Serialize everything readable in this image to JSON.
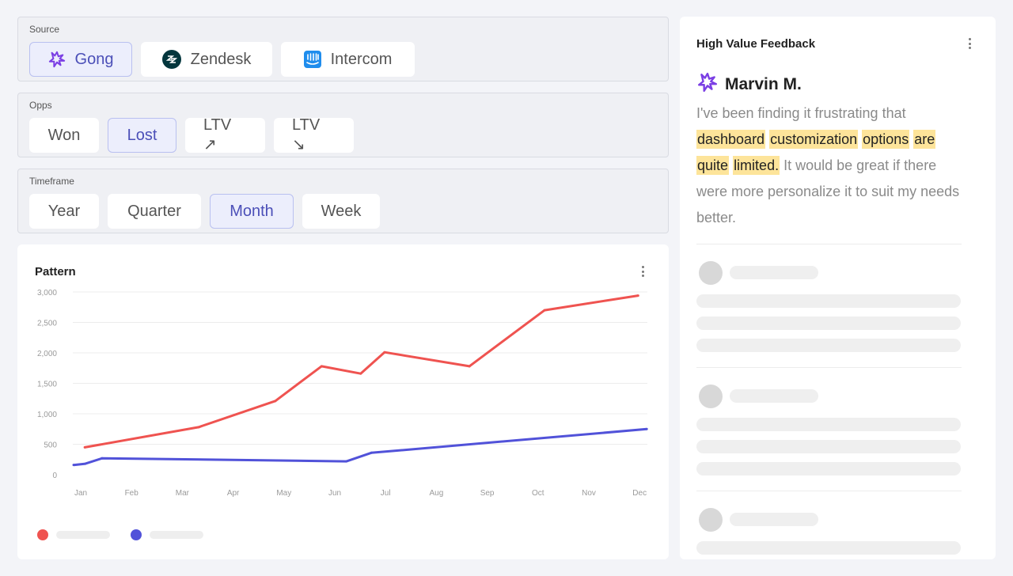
{
  "filters": {
    "source": {
      "label": "Source",
      "options": [
        {
          "label": "Gong",
          "icon": "gong-icon",
          "active": true
        },
        {
          "label": "Zendesk",
          "icon": "zendesk-icon",
          "active": false
        },
        {
          "label": "Intercom",
          "icon": "intercom-icon",
          "active": false
        }
      ]
    },
    "opps": {
      "label": "Opps",
      "options": [
        {
          "label": "Won",
          "active": false
        },
        {
          "label": "Lost",
          "active": true
        },
        {
          "label": "LTV ↗",
          "active": false
        },
        {
          "label": "LTV ↘",
          "active": false
        }
      ]
    },
    "timeframe": {
      "label": "Timeframe",
      "options": [
        {
          "label": "Year",
          "active": false
        },
        {
          "label": "Quarter",
          "active": false
        },
        {
          "label": "Month",
          "active": true
        },
        {
          "label": "Week",
          "active": false
        }
      ]
    }
  },
  "pattern_card": {
    "title": "Pattern",
    "menu_icon": "kebab-menu-icon"
  },
  "chart_data": {
    "type": "line",
    "title": "Pattern",
    "xlabel": "",
    "ylabel": "",
    "categories": [
      "Jan",
      "Feb",
      "Mar",
      "Apr",
      "May",
      "Jun",
      "Jul",
      "Aug",
      "Sep",
      "Oct",
      "Nov",
      "Dec"
    ],
    "yticks": [
      0,
      500,
      1000,
      1500,
      2000,
      2500,
      3000
    ],
    "ytick_labels": [
      "0",
      "500",
      "1,000",
      "1,500",
      "2,000",
      "2,500",
      "3,000"
    ],
    "ylim": [
      0,
      3000
    ],
    "grid": true,
    "legend": "bottom-left",
    "series": [
      {
        "name": "",
        "color": "#ef5350",
        "points": [
          {
            "x": 0.08,
            "y": 450
          },
          {
            "x": 2.32,
            "y": 780
          },
          {
            "x": 3.83,
            "y": 1210
          },
          {
            "x": 4.74,
            "y": 1780
          },
          {
            "x": 5.51,
            "y": 1660
          },
          {
            "x": 5.98,
            "y": 2010
          },
          {
            "x": 7.65,
            "y": 1780
          },
          {
            "x": 9.13,
            "y": 2700
          },
          {
            "x": 10.97,
            "y": 2940
          }
        ]
      },
      {
        "name": "",
        "color": "#5152d9",
        "points": [
          {
            "x": -0.14,
            "y": 160
          },
          {
            "x": 0.09,
            "y": 180
          },
          {
            "x": 0.42,
            "y": 270
          },
          {
            "x": 5.23,
            "y": 220
          },
          {
            "x": 5.72,
            "y": 360
          },
          {
            "x": 11.14,
            "y": 750
          }
        ]
      }
    ]
  },
  "feedback_card": {
    "title": "High Value Feedback",
    "menu_icon": "kebab-menu-icon",
    "author": "Marvin M.",
    "author_source_icon": "gong-icon",
    "quote_segments": [
      {
        "text": "I've been finding it frustrating that ",
        "highlight": false
      },
      {
        "text": "dashboard",
        "highlight": true
      },
      {
        "text": " ",
        "highlight": false
      },
      {
        "text": "customization",
        "highlight": true
      },
      {
        "text": " ",
        "highlight": false
      },
      {
        "text": "options",
        "highlight": true
      },
      {
        "text": " ",
        "highlight": false
      },
      {
        "text": "are",
        "highlight": true
      },
      {
        "text": " ",
        "highlight": false
      },
      {
        "text": "quite",
        "highlight": true
      },
      {
        "text": " ",
        "highlight": false
      },
      {
        "text": "limited.",
        "highlight": true
      },
      {
        "text": " It would be great if there were more personalize it to suit my needs better.",
        "highlight": false
      }
    ],
    "placeholder_items": 3
  },
  "colors": {
    "accent": "#4b4fb8",
    "red_series": "#ef5350",
    "blue_series": "#5152d9",
    "highlight": "#fde49a",
    "gong_purple": "#7b3fe4",
    "zendesk_dark": "#03363d",
    "intercom_blue": "#1f8ded"
  }
}
